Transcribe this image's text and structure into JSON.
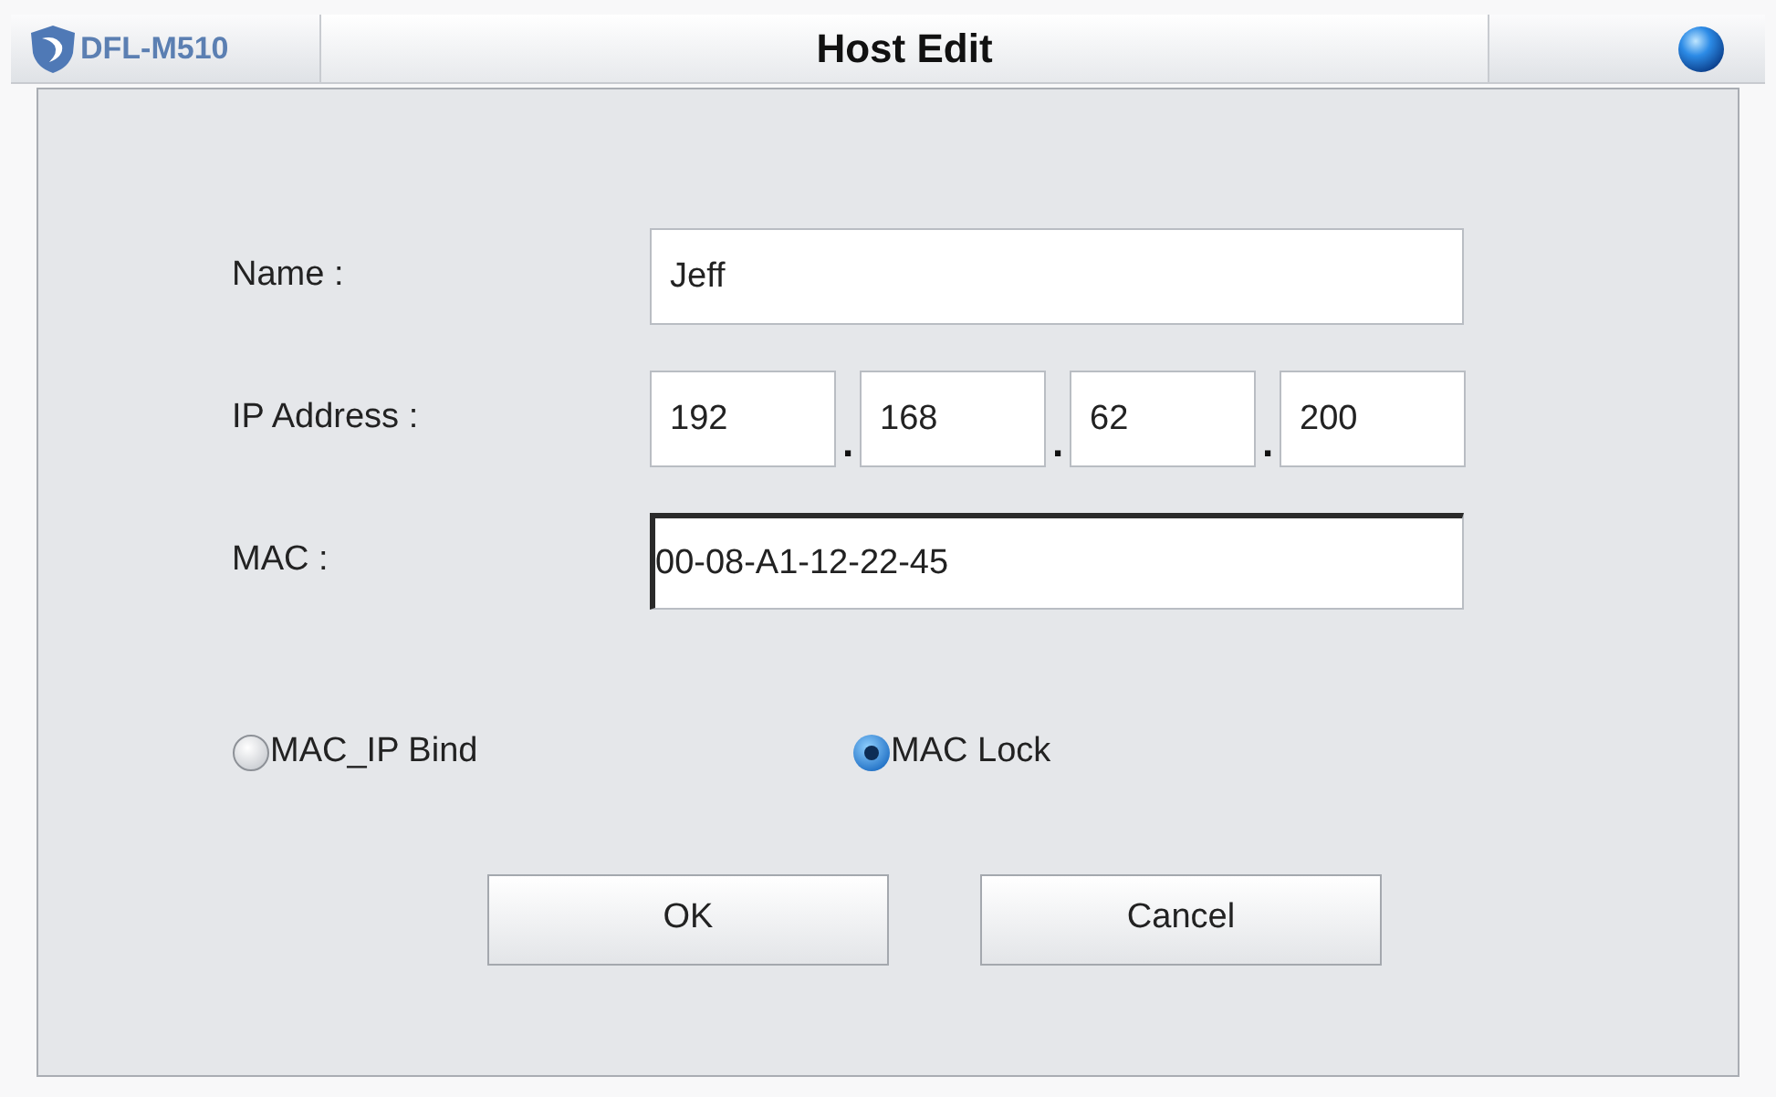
{
  "window": {
    "brand": "DFL-M510",
    "title": "Host Edit"
  },
  "fields": [
    {
      "kind": "text",
      "label": "Name :",
      "value": "Jeff",
      "focused": false
    },
    {
      "kind": "ip",
      "label": "IP Address :",
      "octets": [
        "192",
        "168",
        "62",
        "200"
      ],
      "separators": [
        ".",
        ".",
        "."
      ],
      "focused": false
    },
    {
      "kind": "text",
      "label": "MAC :",
      "value": "00-08-A1-12-22-45",
      "focused": true
    }
  ],
  "options": [
    {
      "label": "MAC_IP Bind",
      "selected": false
    },
    {
      "label": "MAC Lock",
      "selected": true
    }
  ],
  "buttons": [
    {
      "label": "OK"
    },
    {
      "label": "Cancel"
    }
  ]
}
